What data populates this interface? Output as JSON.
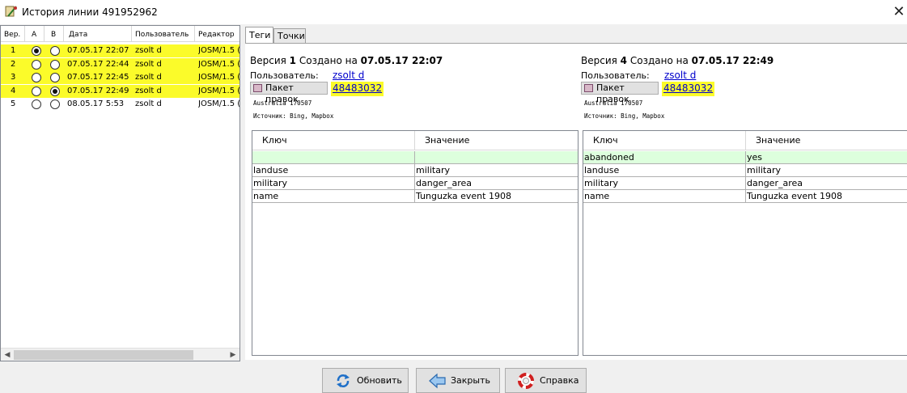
{
  "window": {
    "title": "История линии 491952962",
    "close_glyph": "✕"
  },
  "history": {
    "columns": [
      "Вер.",
      "A",
      "B",
      "Дата",
      "Пользователь",
      "Редактор"
    ],
    "rows": [
      {
        "ver": "1",
        "a": true,
        "b": false,
        "date": "07.05.17 22:07",
        "user": "zsolt d",
        "editor": "JOSM/1.5 (",
        "highlighted": true
      },
      {
        "ver": "2",
        "a": false,
        "b": false,
        "date": "07.05.17 22:44",
        "user": "zsolt d",
        "editor": "JOSM/1.5 (",
        "highlighted": true
      },
      {
        "ver": "3",
        "a": false,
        "b": false,
        "date": "07.05.17 22:45",
        "user": "zsolt d",
        "editor": "JOSM/1.5 (",
        "highlighted": true
      },
      {
        "ver": "4",
        "a": false,
        "b": true,
        "date": "07.05.17 22:49",
        "user": "zsolt d",
        "editor": "JOSM/1.5 (",
        "highlighted": true
      },
      {
        "ver": "5",
        "a": false,
        "b": false,
        "date": "08.05.17 5:53",
        "user": "zsolt d",
        "editor": "JOSM/1.5 (",
        "highlighted": false
      }
    ]
  },
  "tabs": [
    {
      "label": "Теги",
      "active": true
    },
    {
      "label": "Точки",
      "active": false
    }
  ],
  "left_version": {
    "prefix": "Версия ",
    "number": "1",
    "created": " Создано на ",
    "datetime": "07.05.17 22:07",
    "user_label": "Пользователь:",
    "user": "zsolt d",
    "changeset_button": "Пакет правок",
    "changeset_id": "48483032",
    "comment": "Australia 170507",
    "source": "Источник: Bing, Mapbox",
    "header_key": "Ключ",
    "header_value": "Значение",
    "rows": [
      {
        "key": "",
        "value": "",
        "added": true
      },
      {
        "key": "landuse",
        "value": "military",
        "added": false
      },
      {
        "key": "military",
        "value": "danger_area",
        "added": false
      },
      {
        "key": "name",
        "value": "Tunguzka event 1908",
        "added": false
      }
    ]
  },
  "right_version": {
    "prefix": "Версия ",
    "number": "4",
    "created": " Создано на ",
    "datetime": "07.05.17 22:49",
    "user_label": "Пользователь:",
    "user": "zsolt d",
    "changeset_button": "Пакет правок",
    "changeset_id": "48483032",
    "comment": "Australia 170507",
    "source": "Источник: Bing, Mapbox",
    "header_key": "Ключ",
    "header_value": "Значение",
    "rows": [
      {
        "key": "abandoned",
        "value": "yes",
        "added": true
      },
      {
        "key": "landuse",
        "value": "military",
        "added": false
      },
      {
        "key": "military",
        "value": "danger_area",
        "added": false
      },
      {
        "key": "name",
        "value": "Tunguzka event 1908",
        "added": false
      }
    ]
  },
  "buttons": {
    "refresh": {
      "label": "Обновить",
      "icon": "refresh-icon"
    },
    "close": {
      "label": "Закрыть",
      "icon": "back-arrow-icon"
    },
    "help": {
      "label": "Справка",
      "icon": "lifebuoy-icon"
    }
  },
  "colors": {
    "highlight": "#fbfb2a",
    "added_row": "#ddffdd",
    "link": "#0000cc"
  }
}
